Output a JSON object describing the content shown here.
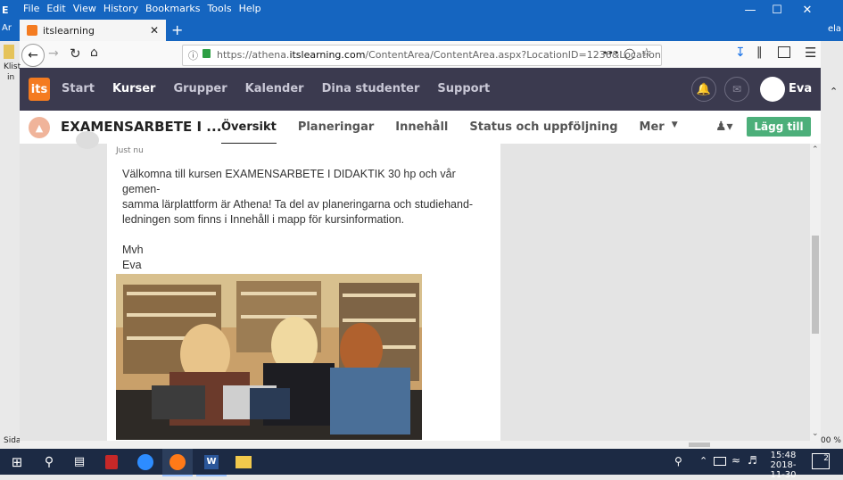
{
  "window": {
    "menu": [
      "File",
      "Edit",
      "View",
      "History",
      "Bookmarks",
      "Tools",
      "Help"
    ]
  },
  "browser": {
    "tab_title": "itslearning",
    "url_prefix": "https://athena.",
    "url_domain": "itslearning.com",
    "url_rest": "/ContentArea/ContentArea.aspx?LocationID=1236&Location",
    "more": "•••"
  },
  "its": {
    "logo": "its",
    "nav": [
      "Start",
      "Kurser",
      "Grupper",
      "Kalender",
      "Dina studenter",
      "Support"
    ],
    "active_nav": "Kurser",
    "user": "Eva"
  },
  "course": {
    "title": "EXAMENSARBETE I ...",
    "tabs": [
      "Översikt",
      "Planeringar",
      "Innehåll",
      "Status och uppföljning",
      "Mer"
    ],
    "add_button": "Lägg till"
  },
  "post": {
    "time": "Just nu",
    "lines": [
      "Välkomna till kursen EXAMENSARBETE I DIDAKTIK 30 hp och vår gemen-",
      "samma lärplattform är Athena! Ta del av planeringarna och studiehand-",
      "ledningen som finns i Innehåll i mapp för kursinformation."
    ],
    "sign1": "Mvh",
    "sign2": "Eva"
  },
  "side_fragments": {
    "left_top": "Ar",
    "left_klist": "Klist",
    "left_in": "in",
    "left_sida": "Sida",
    "right_ela": "ela",
    "right_zoom": "00 %"
  },
  "taskbar": {
    "time": "15:48",
    "date": "2018-11-30",
    "notif": "2"
  }
}
